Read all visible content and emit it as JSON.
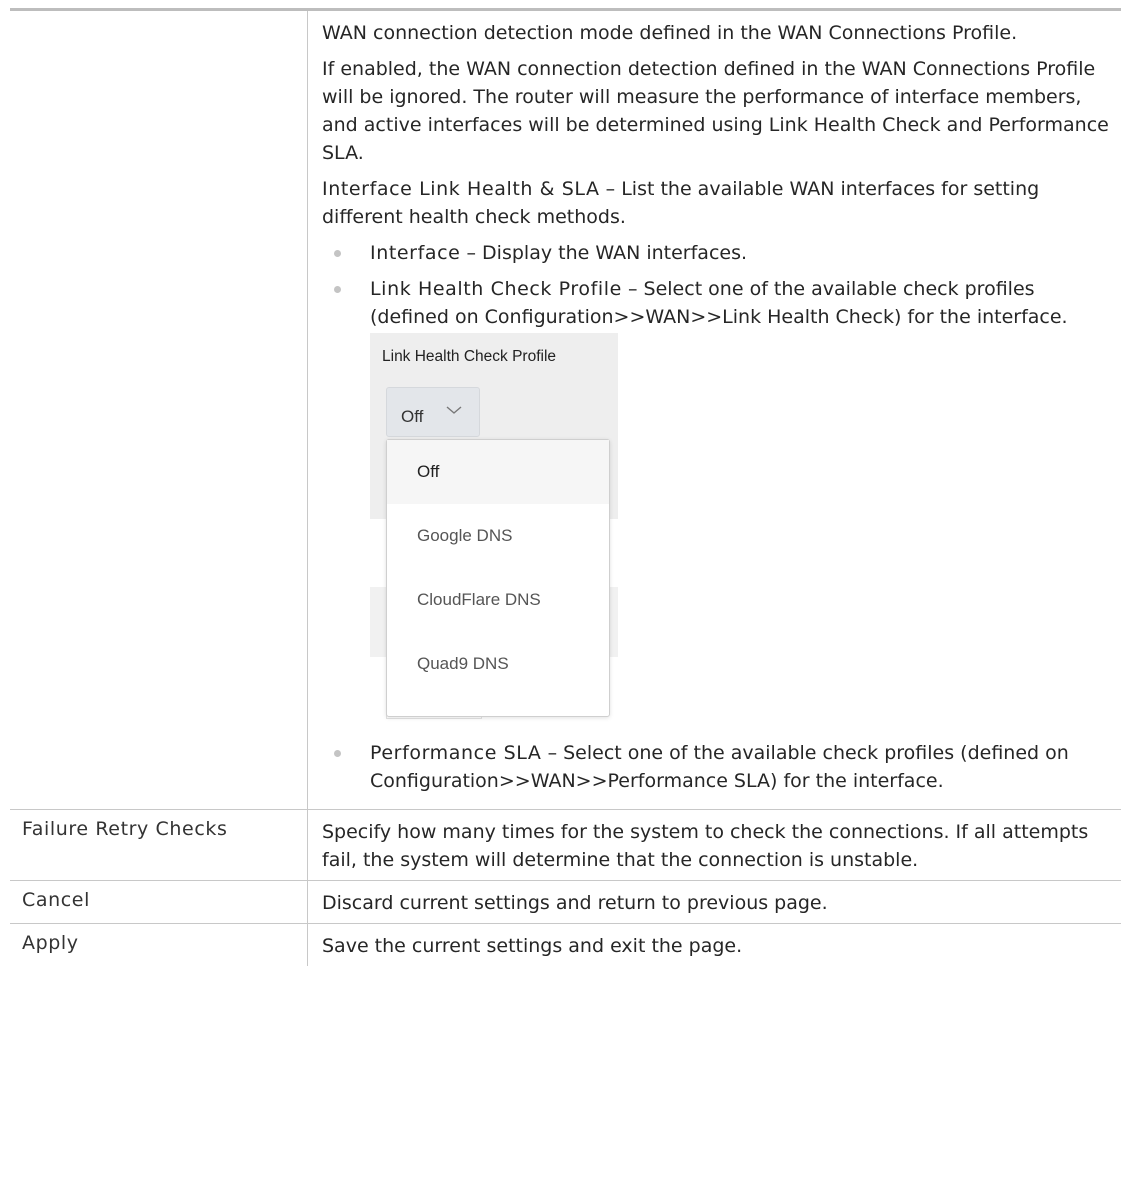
{
  "rows": [
    {
      "label": "",
      "paragraphs": [
        "WAN connection detection mode defined in the WAN Connections Profile.",
        "If enabled, the WAN connection detection defined in the WAN Connections Profile will be ignored. The router will measure the performance of interface members, and active interfaces will be determined using Link Health Check and Performance SLA."
      ],
      "intro": {
        "term": "Interface Link Health & SLA",
        "text": " – List the available WAN interfaces for setting different health check methods."
      },
      "bullets": [
        {
          "term": "Interface",
          "text": " – Display the WAN interfaces."
        },
        {
          "term": "Link Health Check Profile",
          "text": " – Select one of the available check profiles (defined on Configuration>>WAN>>Link Health Check) for the interface."
        },
        {
          "term": "Performance SLA",
          "text": " – Select one of the available check profiles (defined on Configuration>>WAN>>Performance SLA) for the interface."
        }
      ]
    },
    {
      "label": "Failure Retry Checks",
      "text": "Specify how many times for the system to check the connections. If all attempts fail, the system will determine that the connection is unstable."
    },
    {
      "label": "Cancel",
      "text": "Discard current settings and return to previous page."
    },
    {
      "label": "Apply",
      "text": "Save the current settings and exit the page."
    }
  ],
  "screenshot": {
    "caption": "Link Health Check Profile",
    "selected": "Off",
    "options": [
      "Off",
      "Google DNS",
      "CloudFlare DNS",
      "Quad9 DNS"
    ]
  }
}
